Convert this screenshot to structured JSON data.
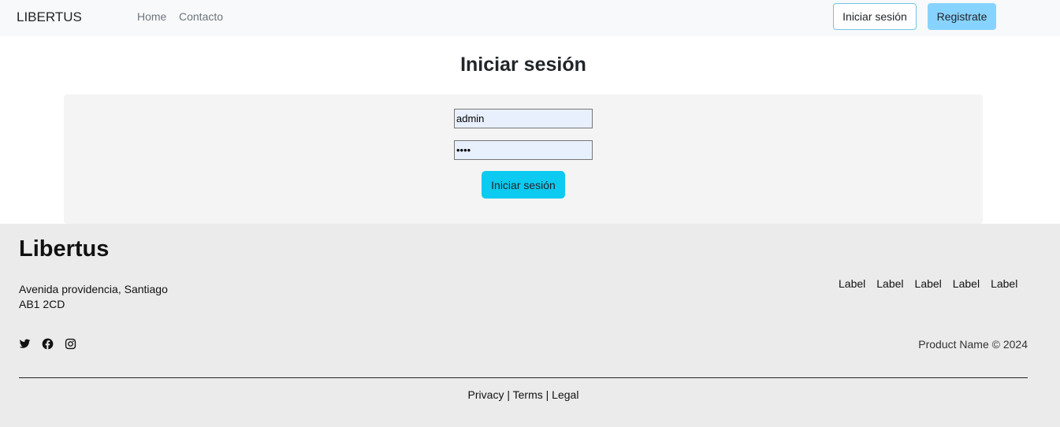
{
  "navbar": {
    "brand": "LIBERTUS",
    "links": [
      "Home",
      "Contacto"
    ],
    "login_button": "Iniciar sesión",
    "register_button": "Registrate"
  },
  "main": {
    "title": "Iniciar sesión",
    "username_value": "admin",
    "password_value": "••••",
    "submit_button": "Iniciar sesión"
  },
  "footer": {
    "title": "Libertus",
    "address_line1": "Avenida providencia, Santiago",
    "address_line2": "AB1 2CD",
    "links": [
      "Label",
      "Label",
      "Label",
      "Label",
      "Label"
    ],
    "socials": [
      "twitter-icon",
      "facebook-icon",
      "instagram-icon"
    ],
    "copyright": "Product Name © 2024",
    "legal": [
      "Privacy",
      "Terms",
      "Legal"
    ],
    "separator": "|"
  }
}
